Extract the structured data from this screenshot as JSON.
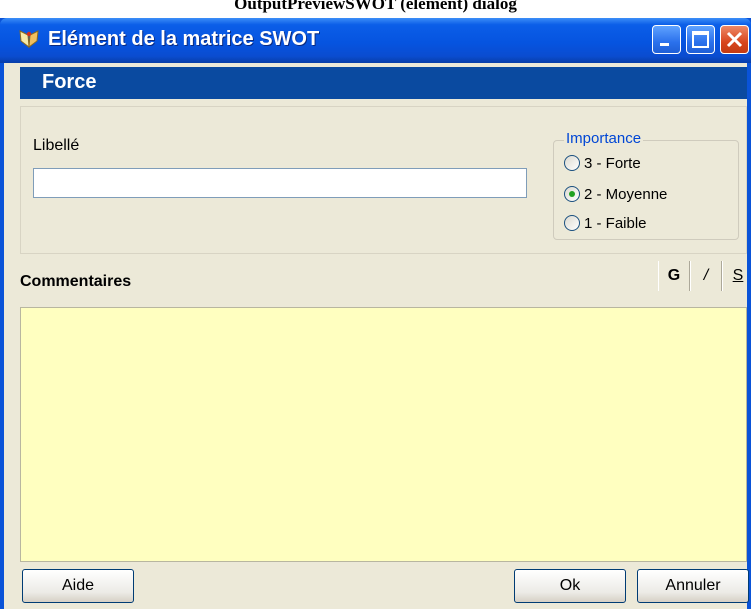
{
  "header_caption": "OutputPreviewSWOT (element) dialog",
  "window": {
    "title": "Elément de la matrice SWOT",
    "app_icon": "swot-app-icon",
    "controls": {
      "minimize": "minimize-icon",
      "maximize": "maximize-icon",
      "close": "close-icon"
    }
  },
  "banner": {
    "title": "Force"
  },
  "form": {
    "libelle_label": "Libellé",
    "libelle_value": "",
    "libelle_placeholder": "",
    "importance": {
      "legend": "Importance",
      "options": [
        {
          "label": "3 - Forte",
          "checked": false
        },
        {
          "label": "2 - Moyenne",
          "checked": true
        },
        {
          "label": "1 - Faible",
          "checked": false
        }
      ]
    },
    "comments_label": "Commentaires",
    "comments_value": "",
    "comments_bg": "#ffffc0",
    "format_toolbar": {
      "bold": "G",
      "italic": "/",
      "underline": "S"
    }
  },
  "buttons": {
    "help": "Aide",
    "ok": "Ok",
    "cancel": "Annuler"
  },
  "colors": {
    "titlebar": "#0654e0",
    "banner": "#0a4aa0",
    "dialog_bg": "#ece9d8",
    "legend_text": "#0046d5"
  }
}
